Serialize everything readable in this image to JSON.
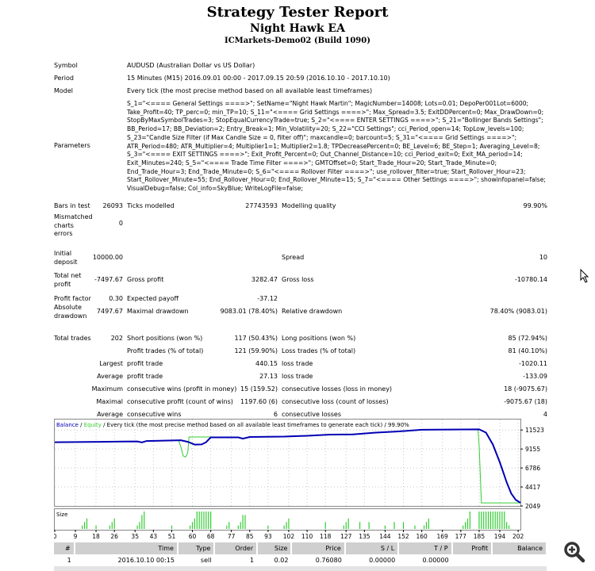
{
  "header": {
    "title": "Strategy Tester Report",
    "ea_name": "Night Hawk EA",
    "server": "ICMarkets-Demo02 (Build 1090)"
  },
  "info": [
    {
      "label": "Symbol",
      "value": "AUDUSD (Australian Dollar vs US Dollar)"
    },
    {
      "label": "Period",
      "value": "15 Minutes (M15) 2016.09.01 00:00 - 2017.09.15 20:59 (2016.10.10 - 2017.10.10)"
    },
    {
      "label": "Model",
      "value": "Every tick (the most precise method based on all available least timeframes)"
    }
  ],
  "parameters": {
    "label": "Parameters",
    "text": "S_1=\"<==== General Settings ====>\"; SetName=\"Night Hawk Martin\"; MagicNumber=14008; Lots=0.01; DepoPer001Lot=6000; Take_Profit=40; TP_perc=0; min_TP=10; S_11=\"<==== Grid Settings ====>\"; Max_Spread=3.5; ExitDDPercent=0; Max_DrawDown=0; StopByMaxSymbolTrades=3; StopEqualCurrencyTrade=true; S_2=\"<==== ENTER SETTINGS ====>\"; S_21=\"Bollinger Bands Settings\"; BB_Period=17; BB_Deviation=2; Entry_Break=1; Min_Volatility=20; S_22=\"CCI Settings\"; cci_Period_open=14; TopLow_levels=100; S_23=\"Candle Size Filter (if Max Candle Size = 0, filter off)\"; maxcandle=0; barcount=5; S_31=\"<==== Grid Settings ====>\"; ATR_Period=480; ATR_Multiplier=4; Multiplier1=1; Multiplier2=1.8; TPDecreasePercent=0; BE_Level=6; BE_Step=1; Averaging_Level=8; S_3=\"<==== EXIT SETTINGS ====>\"; Exit_Profit_Percent=0; Out_Channel_Distance=10; cci_Period_exit=0; Exit_MA_period=14; Exit_Minutes=240; S_5=\"<==== Trade Time Filter ====>\"; GMTOffset=0; Start_Trade_Hour=20; Start_Trade_Minute=0; End_Trade_Hour=3; End_Trade_Minute=0; S_6=\"<==== Rollover Filter ====>\"; use_rollover_filter=true; Start_Rollover_Hour=23; Start_Rollover_Minute=55; End_Rollover_Hour=0; End_Rollover_Minute=15; S_7=\"<==== Other Settings ====>\"; showinfopanel=false; VisualDebug=false; Col_info=SkyBlue; WriteLogFile=false;"
  },
  "stats": {
    "bars_label": "Bars in test",
    "bars": "26093",
    "ticks_label": "Ticks modelled",
    "ticks": "27743593",
    "quality_label": "Modelling quality",
    "quality": "99.90%",
    "mismatch_label": "Mismatched charts errors",
    "mismatch": "0",
    "deposit_label": "Initial deposit",
    "deposit": "10000.00",
    "spread_label": "Spread",
    "spread": "10",
    "net_label": "Total net profit",
    "net": "-7497.67",
    "gross_profit_label": "Gross profit",
    "gross_profit": "3282.47",
    "gross_loss_label": "Gross loss",
    "gross_loss": "-10780.14",
    "pf_label": "Profit factor",
    "pf": "0.30",
    "payoff_label": "Expected payoff",
    "payoff": "-37.12",
    "abs_dd_label": "Absolute drawdown",
    "abs_dd": "7497.67",
    "max_dd_label": "Maximal drawdown",
    "max_dd": "9083.01 (78.40%)",
    "rel_dd_label": "Relative drawdown",
    "rel_dd": "78.40% (9083.01)",
    "total_label": "Total trades",
    "total": "202",
    "short_label": "Short positions (won %)",
    "short": "117 (50.43%)",
    "long_label": "Long positions (won %)",
    "long": "85 (72.94%)",
    "ptrades_label": "Profit trades (% of total)",
    "ptrades": "121 (59.90%)",
    "ltrades_label": "Loss trades (% of total)",
    "ltrades": "81 (40.10%)",
    "largest": "Largest",
    "avg": "Average",
    "maximum": "Maximum",
    "maximal": "Maximal",
    "average2": "Average",
    "lp_label": "profit trade",
    "lp": "440.15",
    "ll_label": "loss trade",
    "ll": "-1020.11",
    "ap_label": "profit trade",
    "ap": "27.13",
    "al_label": "loss trade",
    "al": "-133.09",
    "mcw_label": "consecutive wins (profit in money)",
    "mcw": "15 (159.52)",
    "mcl_label": "consecutive losses (loss in money)",
    "mcl": "18 (-9075.67)",
    "mcp_label": "consecutive profit (count of wins)",
    "mcp": "1197.60 (6)",
    "mclo_label": "consecutive loss (count of losses)",
    "mclo": "-9075.67 (18)",
    "acw_label": "consecutive wins",
    "acw": "6",
    "acl_label": "consecutive losses",
    "acl": "4"
  },
  "chart_data": {
    "type": "line",
    "legend": {
      "balance": "Balance",
      "sep1": " / ",
      "equity": "Equity",
      "rest": " / Every tick (the most precise method based on all available least timeframes to generate each tick) / 99.90%"
    },
    "colors": {
      "balance": "#0000b4",
      "equity": "#33cc33",
      "size_bars": "#33cc33",
      "grid": "#c8c8c8"
    },
    "y_ticks": [
      11523,
      9155,
      6786,
      4417,
      2049
    ],
    "x_ticks": [
      0,
      9,
      18,
      26,
      35,
      43,
      51,
      60,
      68,
      77,
      85,
      93,
      102,
      110,
      118,
      127,
      135,
      144,
      152,
      160,
      169,
      177,
      185,
      194,
      202
    ],
    "xlim": [
      0,
      203
    ],
    "ylim": [
      2049,
      12830
    ],
    "grid": true,
    "balance": [
      [
        0,
        10000
      ],
      [
        15,
        10030
      ],
      [
        30,
        10080
      ],
      [
        36,
        10100
      ],
      [
        38,
        9980
      ],
      [
        40,
        10150
      ],
      [
        55,
        10250
      ],
      [
        58,
        10050
      ],
      [
        61,
        9700
      ],
      [
        64,
        9720
      ],
      [
        66,
        10000
      ],
      [
        68,
        10600
      ],
      [
        80,
        10600
      ],
      [
        82,
        10450
      ],
      [
        85,
        10650
      ],
      [
        100,
        10700
      ],
      [
        110,
        10800
      ],
      [
        120,
        10950
      ],
      [
        130,
        10980
      ],
      [
        140,
        11200
      ],
      [
        150,
        11350
      ],
      [
        160,
        11550
      ],
      [
        185,
        11600
      ],
      [
        188,
        11200
      ],
      [
        191,
        9700
      ],
      [
        194,
        7500
      ],
      [
        197,
        5000
      ],
      [
        199,
        3600
      ],
      [
        201,
        2800
      ],
      [
        203,
        2450
      ]
    ],
    "equity": [
      [
        0,
        10000
      ],
      [
        15,
        10030
      ],
      [
        30,
        10080
      ],
      [
        36,
        10100
      ],
      [
        38,
        10000
      ],
      [
        40,
        10150
      ],
      [
        54,
        10250
      ],
      [
        55,
        9400
      ],
      [
        56,
        8300
      ],
      [
        57,
        8150
      ],
      [
        58,
        8700
      ],
      [
        58.5,
        10650
      ],
      [
        68,
        10650
      ],
      [
        80,
        10600
      ],
      [
        82,
        10500
      ],
      [
        85,
        10650
      ],
      [
        100,
        10700
      ],
      [
        110,
        10800
      ],
      [
        120,
        10950
      ],
      [
        130,
        10980
      ],
      [
        140,
        11200
      ],
      [
        150,
        11350
      ],
      [
        160,
        11550
      ],
      [
        184.5,
        11600
      ],
      [
        185,
        9500
      ],
      [
        186,
        2430
      ],
      [
        203,
        2430
      ]
    ],
    "size_label": "Size",
    "sizes": [
      [
        12,
        1
      ],
      [
        13,
        2
      ],
      [
        14,
        3
      ],
      [
        18,
        1
      ],
      [
        24,
        1
      ],
      [
        25,
        2
      ],
      [
        26,
        3
      ],
      [
        36,
        1
      ],
      [
        37,
        2
      ],
      [
        38,
        4
      ],
      [
        39,
        5
      ],
      [
        51,
        1
      ],
      [
        59,
        1
      ],
      [
        60,
        2
      ],
      [
        61,
        3
      ],
      [
        62,
        5
      ],
      [
        63,
        5
      ],
      [
        64,
        5
      ],
      [
        65,
        5
      ],
      [
        66,
        5
      ],
      [
        67,
        5
      ],
      [
        68,
        5
      ],
      [
        75,
        1
      ],
      [
        76,
        2
      ],
      [
        80,
        1
      ],
      [
        81,
        2
      ],
      [
        82,
        4
      ],
      [
        83,
        4
      ],
      [
        93,
        1
      ],
      [
        100,
        1
      ],
      [
        101,
        2
      ],
      [
        102,
        3
      ],
      [
        118,
        2
      ],
      [
        126,
        1
      ],
      [
        127,
        2
      ],
      [
        128,
        3
      ],
      [
        133,
        2
      ],
      [
        137,
        2
      ],
      [
        144,
        1
      ],
      [
        148,
        2
      ],
      [
        152,
        2
      ],
      [
        157,
        1
      ],
      [
        161,
        1
      ],
      [
        162,
        2
      ],
      [
        163,
        3
      ],
      [
        178,
        1
      ],
      [
        179,
        2
      ],
      [
        180,
        3
      ],
      [
        181,
        5
      ],
      [
        185,
        5
      ],
      [
        186,
        5
      ],
      [
        187,
        5
      ],
      [
        188,
        5
      ],
      [
        189,
        5
      ],
      [
        190,
        5
      ],
      [
        191,
        5
      ],
      [
        192,
        5
      ],
      [
        193,
        5
      ],
      [
        194,
        5
      ],
      [
        195,
        5
      ],
      [
        196,
        5
      ],
      [
        197,
        2
      ],
      [
        198,
        1
      ]
    ]
  },
  "trades": {
    "columns": [
      "#",
      "Time",
      "Type",
      "Order",
      "Size",
      "Price",
      "S / L",
      "T / P",
      "Profit",
      "Balance"
    ],
    "rows": [
      [
        "1",
        "2016.10.10 00:15",
        "sell",
        "1",
        "0.02",
        "0.76080",
        "0.00000",
        "0.00000",
        "",
        ""
      ]
    ]
  },
  "icons": {
    "zoom": "zoom-in-icon",
    "cursor": "mouse-cursor-icon"
  }
}
